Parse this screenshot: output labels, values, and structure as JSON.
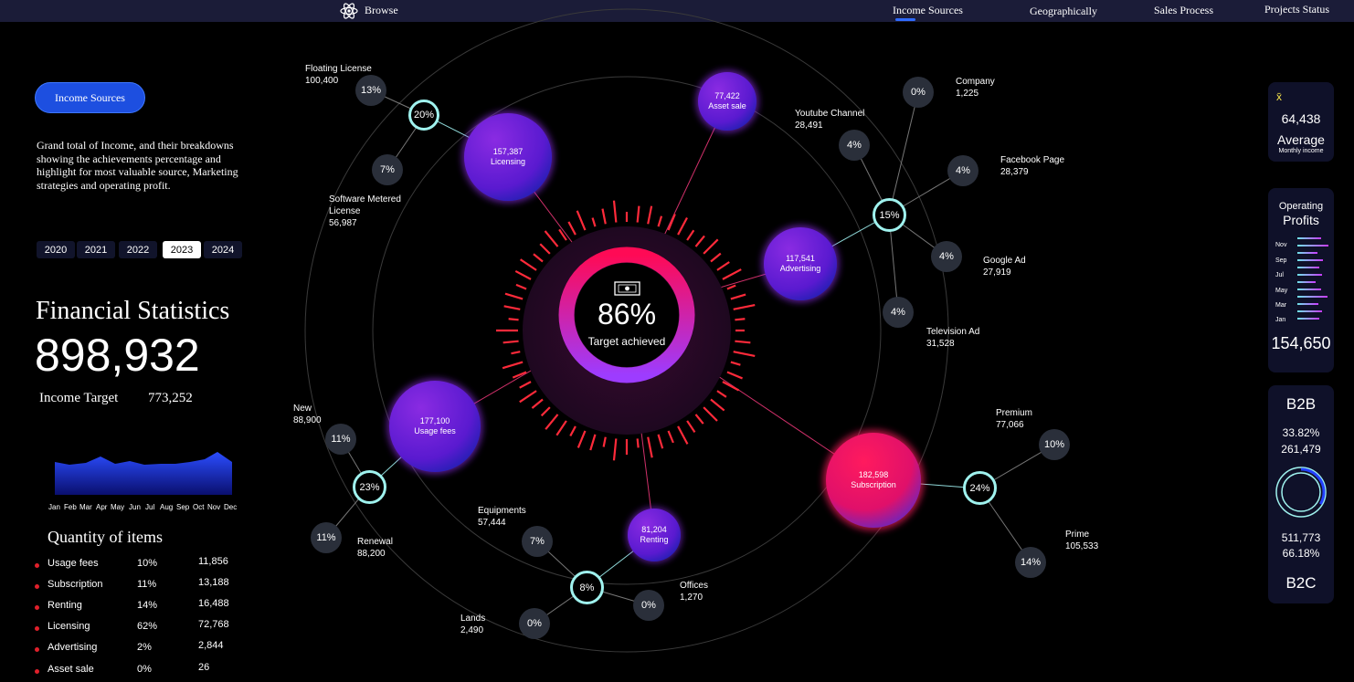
{
  "nav": {
    "browse": "Browse",
    "tabs": [
      "Income Sources",
      "Geographically",
      "Sales Process",
      "Projects Status"
    ],
    "active_tab": "Income Sources"
  },
  "sidebar": {
    "pill": "Income Sources",
    "description": "Grand total of Income, and their breakdowns showing the achievements percentage and highlight for most valuable source, Marketing strategies and operating profit.",
    "years": [
      "2020",
      "2021",
      "2022",
      "2023",
      "2024"
    ],
    "active_year": "2023",
    "title": "Financial Statistics",
    "total": "898,932",
    "target_label": "Income Target",
    "target_value": "773,252",
    "months": [
      "Jan",
      "Feb",
      "Mar",
      "Apr",
      "May",
      "Jun",
      "Jul",
      "Aug",
      "Sep",
      "Oct",
      "Nov",
      "Dec"
    ],
    "quantity_title": "Quantity of items",
    "quantity": [
      {
        "name": "Usage fees",
        "pct": "10%",
        "value": "11,856"
      },
      {
        "name": "Subscription",
        "pct": "11%",
        "value": "13,188"
      },
      {
        "name": "Renting",
        "pct": "14%",
        "value": "16,488"
      },
      {
        "name": "Licensing",
        "pct": "62%",
        "value": "72,768"
      },
      {
        "name": "Advertising",
        "pct": "2%",
        "value": "2,844"
      },
      {
        "name": "Asset sale",
        "pct": "0%",
        "value": "26"
      }
    ]
  },
  "center": {
    "pct": "86%",
    "caption": "Target achieved",
    "achieved": 0.86
  },
  "bubbles": {
    "licensing": {
      "value": "157,387",
      "label": "Licensing"
    },
    "asset_sale": {
      "value": "77,422",
      "label": "Asset sale"
    },
    "advertising": {
      "value": "117,541",
      "label": "Advertising"
    },
    "usage_fees": {
      "value": "177,100",
      "label": "Usage fees"
    },
    "renting": {
      "value": "81,204",
      "label": "Renting"
    },
    "subscription": {
      "value": "182,598",
      "label": "Subscription"
    }
  },
  "hubs": {
    "licensing": "20%",
    "advertising": "15%",
    "usage_fees": "23%",
    "renting": "8%",
    "subscription": "24%"
  },
  "leaves": {
    "floating_license": {
      "name": "Floating License",
      "value": "100,400",
      "pct": "13%"
    },
    "software_metered": {
      "name": "Software Metered License",
      "value": "56,987",
      "pct": "7%"
    },
    "company": {
      "name": "Company",
      "value": "1,225",
      "pct": "0%"
    },
    "youtube": {
      "name": "Youtube Channel",
      "value": "28,491",
      "pct": "4%"
    },
    "facebook": {
      "name": "Facebook Page",
      "value": "28,379",
      "pct": "4%"
    },
    "google": {
      "name": "Google Ad",
      "value": "27,919",
      "pct": "4%"
    },
    "television": {
      "name": "Television Ad",
      "value": "31,528",
      "pct": "4%"
    },
    "new": {
      "name": "New",
      "value": "88,900",
      "pct": "11%"
    },
    "renewal": {
      "name": "Renewal",
      "value": "88,200",
      "pct": "11%"
    },
    "equipments": {
      "name": "Equipments",
      "value": "57,444",
      "pct": "7%"
    },
    "offices": {
      "name": "Offices",
      "value": "1,270",
      "pct": "0%"
    },
    "lands": {
      "name": "Lands",
      "value": "2,490",
      "pct": "0%"
    },
    "premium": {
      "name": "Premium",
      "value": "77,066",
      "pct": "10%"
    },
    "prime": {
      "name": "Prime",
      "value": "105,533",
      "pct": "14%"
    }
  },
  "right": {
    "avg_symbol": "x̄",
    "avg_value": "64,438",
    "avg_label": "Average",
    "avg_sub": "Monthly income",
    "op_title1": "Operating",
    "op_title2": "Profits",
    "op_months": [
      "Nov",
      "Sep",
      "Jul",
      "May",
      "Mar",
      "Jan"
    ],
    "op_total": "154,650",
    "b2b_label": "B2B",
    "b2b_pct": "33.82%",
    "b2b_value": "261,479",
    "b2c_value": "511,773",
    "b2c_pct": "66.18%",
    "b2c_label": "B2C"
  },
  "colors": {
    "accent": "#1d4fe0",
    "ring": "#9ff2ee",
    "bubble_purple": "#6a1fd0",
    "bubble_pink": "#ff1060",
    "tick_red": "#ff2a3a"
  }
}
